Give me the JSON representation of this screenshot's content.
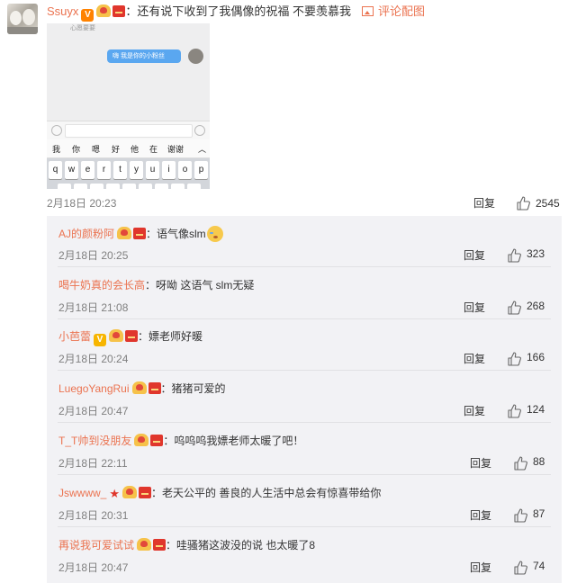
{
  "main_comment": {
    "username": "Ssuyx",
    "text": "：还有说下收到了我偶像的祝福 不要羡慕我",
    "pic_link": "评论配图",
    "time": "2月18日 20:23",
    "reply_label": "回复",
    "likes": "2545",
    "screenshot": {
      "old_message": "心愿要要",
      "bubble_text": "嗨 我是你的小粉丝",
      "candidates": [
        "我",
        "你",
        "嗯",
        "好",
        "他",
        "在",
        "谢谢",
        "︿"
      ],
      "keys": [
        "q",
        "w",
        "e",
        "r",
        "t",
        "y",
        "u",
        "i",
        "o",
        "p"
      ]
    }
  },
  "replies": [
    {
      "username": "AJ的颜粉阿",
      "text": "：语气像slm",
      "time": "2月18日 20:25",
      "reply_label": "回复",
      "likes": "323",
      "badges": [
        "fan",
        "red"
      ],
      "emoji": "cry-laugh-icon"
    },
    {
      "username": "喝牛奶真的会长高",
      "text": "：呀呦 这语气 slm无疑",
      "time": "2月18日 21:08",
      "reply_label": "回复",
      "likes": "268",
      "badges": []
    },
    {
      "username": "小芭蕾",
      "text": "：嫖老师好暖",
      "time": "2月18日 20:24",
      "reply_label": "回复",
      "likes": "166",
      "badges": [
        "v-yellow",
        "fan",
        "red"
      ]
    },
    {
      "username": "LuegoYangRui",
      "text": "：猪猪可爱的",
      "time": "2月18日 20:47",
      "reply_label": "回复",
      "likes": "124",
      "badges": [
        "fan",
        "red"
      ]
    },
    {
      "username": "T_T帅到没朋友",
      "text": "：呜呜呜我嫖老师太暖了吧！",
      "time": "2月18日 22:11",
      "reply_label": "回复",
      "likes": "88",
      "badges": [
        "fan",
        "red"
      ]
    },
    {
      "username": "Jswwww_",
      "text": "：老天公平的 善良的人生活中总会有惊喜带给你",
      "time": "2月18日 20:31",
      "reply_label": "回复",
      "likes": "87",
      "badges": [
        "star",
        "fan",
        "red"
      ]
    },
    {
      "username": "再说我可爱试试",
      "text": "：哇骚猪这波没的说 也太暖了8",
      "time": "2月18日 20:47",
      "reply_label": "回复",
      "likes": "74",
      "badges": [
        "fan",
        "red"
      ]
    }
  ],
  "colors": {
    "username": "#eb7350",
    "meta": "#808080",
    "subbg": "#f2f2f5"
  }
}
